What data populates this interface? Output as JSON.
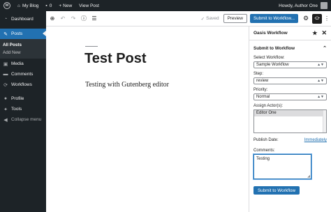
{
  "adminbar": {
    "site_name": "My Blog",
    "comments_count": "0",
    "new_label": "New",
    "view_post_label": "View Post",
    "howdy": "Howdy, Author One"
  },
  "sidebar": {
    "items": [
      {
        "label": "Dashboard",
        "icon": "dashboard-icon"
      },
      {
        "label": "Posts",
        "icon": "pin-icon"
      },
      {
        "label": "Media",
        "icon": "media-icon"
      },
      {
        "label": "Comments",
        "icon": "comments-icon"
      },
      {
        "label": "Workflows",
        "icon": "workflows-icon"
      },
      {
        "label": "Profile",
        "icon": "user-icon"
      },
      {
        "label": "Tools",
        "icon": "tools-icon"
      },
      {
        "label": "Collapse menu",
        "icon": "collapse-icon"
      }
    ],
    "submenu": [
      "All Posts",
      "Add New"
    ]
  },
  "toolbar": {
    "saved_label": "Saved",
    "preview_label": "Preview",
    "submit_label": "Submit to Workflow..."
  },
  "post": {
    "title": "Test Post",
    "body": "Testing with Gutenberg editor"
  },
  "panel": {
    "title": "Oasis Workflow",
    "section_title": "Submit to Workflow",
    "select_workflow_label": "Select Workflow:",
    "select_workflow_value": "Sample Workflow",
    "step_label": "Step:",
    "step_value": "review",
    "priority_label": "Priority:",
    "priority_value": "Normal",
    "assign_label": "Assign Actor(s):",
    "actors": [
      "Editor One"
    ],
    "publish_date_label": "Publish Date:",
    "publish_date_value": "Immediately",
    "comments_label": "Comments:",
    "comments_value": "Testing",
    "submit_label": "Submit to Workflow"
  },
  "colors": {
    "accent": "#2271b1",
    "admin_dark": "#1d2327"
  }
}
